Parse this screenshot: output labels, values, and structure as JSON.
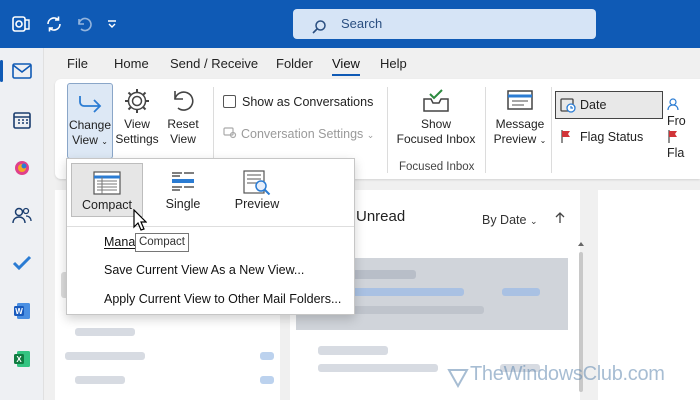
{
  "titlebar": {
    "search_placeholder": "Search",
    "bg_color": "#0f5ab5"
  },
  "menu": {
    "tabs": [
      "File",
      "Home",
      "Send / Receive",
      "Folder",
      "View",
      "Help"
    ],
    "active_tab": "View"
  },
  "ribbon": {
    "change_view": {
      "line1": "Change",
      "line2": "View"
    },
    "view_settings": {
      "line1": "View",
      "line2": "Settings"
    },
    "reset_view": {
      "line1": "Reset",
      "line2": "View"
    },
    "show_as_conversations": "Show as Conversations",
    "conversation_settings": "Conversation Settings",
    "show_focused_inbox": {
      "line1": "Show",
      "line2": "Focused Inbox"
    },
    "focused_inbox_group": "Focused Inbox",
    "message_preview": {
      "line1": "Message",
      "line2": "Preview"
    },
    "arrangement": {
      "date": "Date",
      "flag_status": "Flag Status",
      "from": "Fro",
      "flag2": "Fla"
    }
  },
  "list_header": {
    "title": "Unread",
    "sort": "By Date"
  },
  "dropdown": {
    "views": [
      {
        "label": "Compact",
        "icon": "compact-view-icon",
        "selected": true
      },
      {
        "label": "Single",
        "icon": "single-view-icon",
        "selected": false
      },
      {
        "label": "Preview",
        "icon": "preview-view-icon",
        "selected": false
      }
    ],
    "items": [
      "Mana",
      "Save Current View As a New View...",
      "Apply Current View to Other Mail Folders..."
    ]
  },
  "tooltip": "Compact",
  "watermark": "TheWindowsClub.com"
}
